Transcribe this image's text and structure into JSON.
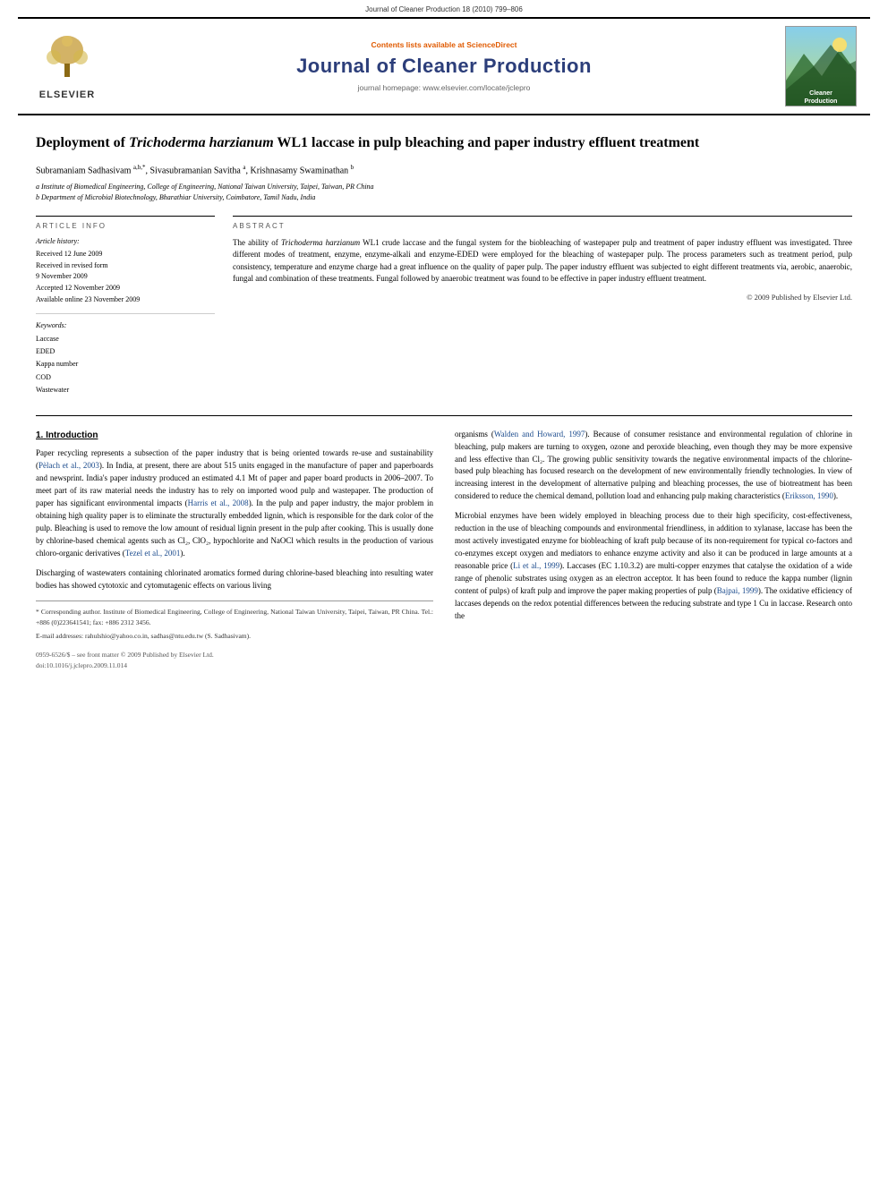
{
  "header": {
    "journal_ref": "Journal of Cleaner Production 18 (2010) 799–806",
    "sciencedirect_label": "Contents lists available at",
    "sciencedirect_link": "ScienceDirect",
    "journal_title": "Journal of Cleaner Production",
    "homepage_label": "journal homepage: www.elsevier.com/locate/jclepro",
    "elsevier_label": "ELSEVIER",
    "badge_line1": "Cleaner",
    "badge_line2": "Production"
  },
  "article": {
    "title_part1": "Deployment of ",
    "title_italic": "Trichoderma harzianum",
    "title_part2": " WL1 laccase in pulp bleaching and paper industry effluent treatment",
    "authors": "Subramaniam Sadhasivam a,b,*, Sivasubramanian Savitha a, Krishnasamy Swaminathan b",
    "author_sups": [
      "a,b,*",
      "a",
      "b"
    ],
    "affiliation_a": "a Institute of Biomedical Engineering, College of Engineering, National Taiwan University, Taipei, Taiwan, PR China",
    "affiliation_b": "b Department of Microbial Biotechnology, Bharathiar University, Coimbatore, Tamil Nadu, India"
  },
  "article_info": {
    "header": "ARTICLE INFO",
    "history_label": "Article history:",
    "received": "Received 12 June 2009",
    "received_revised": "Received in revised form",
    "received_revised_date": "9 November 2009",
    "accepted": "Accepted 12 November 2009",
    "available": "Available online 23 November 2009",
    "keywords_label": "Keywords:",
    "keywords": [
      "Laccase",
      "EDED",
      "Kappa number",
      "COD",
      "Wastewater"
    ]
  },
  "abstract": {
    "header": "ABSTRACT",
    "text": "The ability of Trichoderma harzianum WL1 crude laccase and the fungal system for the biobleaching of wastepaper pulp and treatment of paper industry effluent was investigated. Three different modes of treatment, enzyme, enzyme-alkali and enzyme-EDED were employed for the bleaching of wastepaper pulp. The process parameters such as treatment period, pulp consistency, temperature and enzyme charge had a great influence on the quality of paper pulp. The paper industry effluent was subjected to eight different treatments via, aerobic, anaerobic, fungal and combination of these treatments. Fungal followed by anaerobic treatment was found to be effective in paper industry effluent treatment.",
    "copyright": "© 2009 Published by Elsevier Ltd."
  },
  "intro": {
    "section_number": "1.",
    "section_title": "Introduction",
    "para1": "Paper recycling represents a subsection of the paper industry that is being oriented towards re-use and sustainability (Pèlach et al., 2003). In India, at present, there are about 515 units engaged in the manufacture of paper and paperboards and newsprint. India's paper industry produced an estimated 4.1 Mt of paper and paper board products in 2006–2007. To meet part of its raw material needs the industry has to rely on imported wood pulp and wastepaper. The production of paper has significant environmental impacts (Harris et al., 2008). In the pulp and paper industry, the major problem in obtaining high quality paper is to eliminate the structurally embedded lignin, which is responsible for the dark color of the pulp. Bleaching is used to remove the low amount of residual lignin present in the pulp after cooking. This is usually done by chlorine-based chemical agents such as Cl₂, ClO₂, hypochlorite and NaOCl which results in the production of various chloro-organic derivatives (Tezel et al., 2001).",
    "para2": "Discharging of wastewaters containing chlorinated aromatics formed during chlorine-based bleaching into resulting water bodies has showed cytotoxic and cytomutagenic effects on various living",
    "para3_right": "organisms (Walden and Howard, 1997). Because of consumer resistance and environmental regulation of chlorine in bleaching, pulp makers are turning to oxygen, ozone and peroxide bleaching, even though they may be more expensive and less effective than Cl₂. The growing public sensitivity towards the negative environmental impacts of the chlorine-based pulp bleaching has focused research on the development of new environmentally friendly technologies. In view of increasing interest in the development of alternative pulping and bleaching processes, the use of biotreatment has been considered to reduce the chemical demand, pollution load and enhancing pulp making characteristics (Eriksson, 1990).",
    "para4_right": "Microbial enzymes have been widely employed in bleaching process due to their high specificity, cost-effectiveness, reduction in the use of bleaching compounds and environmental friendliness, in addition to xylanase, laccase has been the most actively investigated enzyme for biobleaching of kraft pulp because of its non-requirement for typical co-factors and co-enzymes except oxygen and mediators to enhance enzyme activity and also it can be produced in large amounts at a reasonable price (Li et al., 1999). Laccases (EC 1.10.3.2) are multi-copper enzymes that catalyse the oxidation of a wide range of phenolic substrates using oxygen as an electron acceptor. It has been found to reduce the kappa number (lignin content of pulps) of kraft pulp and improve the paper making properties of pulp (Bajpai, 1999). The oxidative efficiency of laccases depends on the redox potential differences between the reducing substrate and type 1 Cu in laccase. Research onto the"
  },
  "footnotes": {
    "corresponding": "* Corresponding author. Institute of Biomedical Engineering, College of Engineering, National Taiwan University, Taipei, Taiwan, PR China. Tel.: +886 (0)223641541; fax: +886 2312 3456.",
    "email": "E-mail addresses: rahulshio@yahoo.co.in, sadhas@ntu.edu.tw (S. Sadhasivam)."
  },
  "bottom": {
    "issn": "0959-6526/$ – see front matter © 2009 Published by Elsevier Ltd.",
    "doi": "doi:10.1016/j.jclepro.2009.11.014"
  }
}
